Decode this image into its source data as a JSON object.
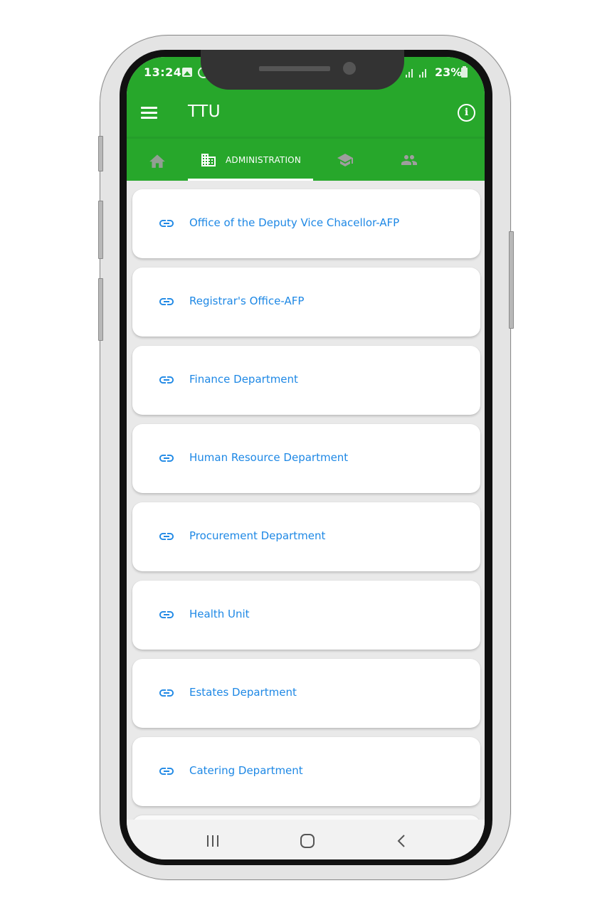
{
  "status_bar": {
    "time": "13:24",
    "icons": [
      "gallery-icon",
      "whatsapp-icon",
      "signal-icon",
      "signal-icon",
      "battery-icon"
    ],
    "battery_percent": "23%"
  },
  "app_bar": {
    "menu_icon": "hamburger-menu-icon",
    "title": "TTU",
    "info_icon": "info-icon",
    "background_color": "#27a72b"
  },
  "tabs": [
    {
      "icon": "home-icon",
      "label": "",
      "active": false
    },
    {
      "icon": "building-icon",
      "label": "ADMINISTRATION",
      "active": true
    },
    {
      "icon": "graduation-cap-icon",
      "label": "",
      "active": false
    },
    {
      "icon": "people-icon",
      "label": "",
      "active": false
    }
  ],
  "list": {
    "item_icon": "link-icon",
    "link_color": "#1e88e5",
    "items": [
      {
        "label": "Office of the Deputy Vice Chacellor-AFP"
      },
      {
        "label": "Registrar's Office-AFP"
      },
      {
        "label": "Finance Department"
      },
      {
        "label": "Human Resource Department"
      },
      {
        "label": "Procurement Department"
      },
      {
        "label": "Health Unit"
      },
      {
        "label": "Estates Department"
      },
      {
        "label": "Catering Department"
      }
    ]
  },
  "nav_bar": {
    "buttons": [
      "recent-apps-icon",
      "home-circle-icon",
      "back-icon"
    ]
  }
}
